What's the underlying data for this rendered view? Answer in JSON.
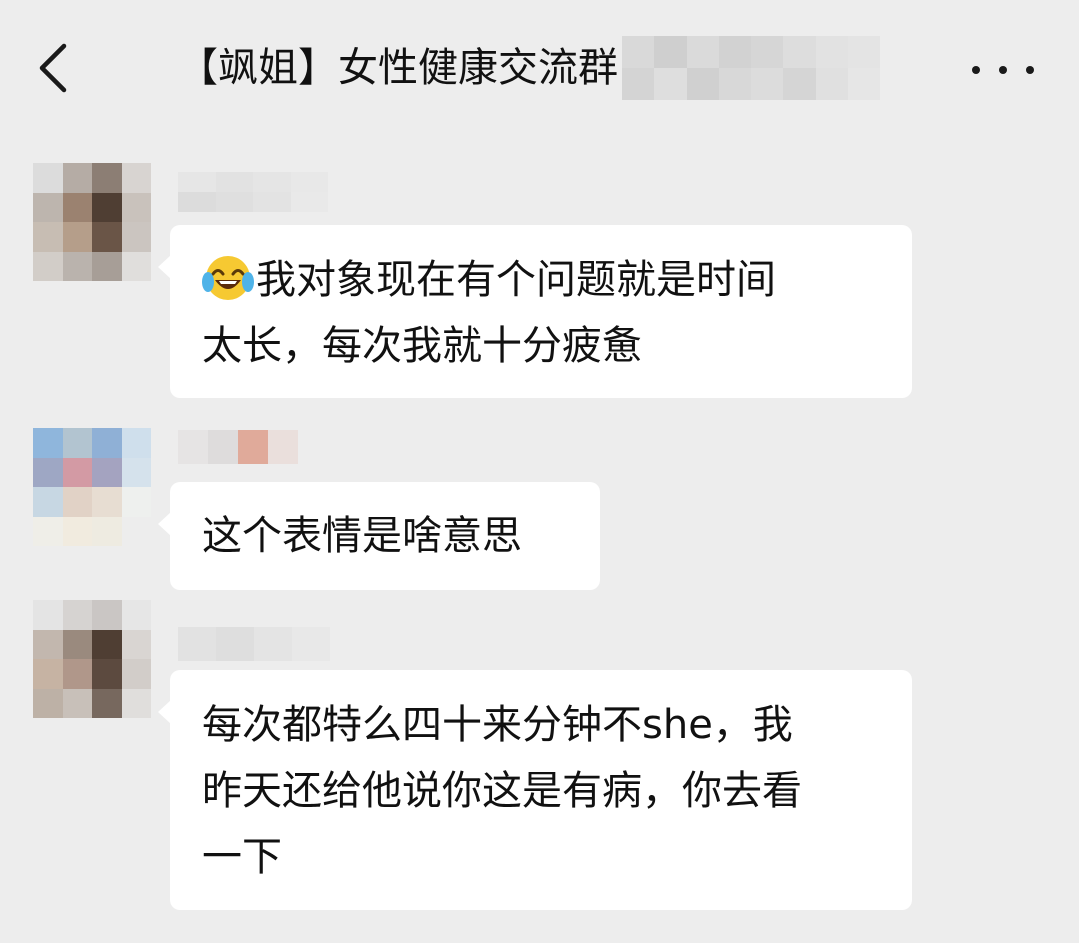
{
  "header": {
    "back_icon": "chevron-left-icon",
    "title": "【飒姐】女性健康交流群",
    "more_icon": "more-horizontal-icon"
  },
  "messages": [
    {
      "emoji": "tears-of-joy-emoji",
      "lines": [
        "我对象现在有个问题就是时间",
        "太长，每次我就十分疲惫"
      ]
    },
    {
      "lines": [
        "这个表情是啥意思"
      ]
    },
    {
      "lines": [
        "每次都特么四十来分钟不she，我",
        "昨天还给他说你这是有病，你去看",
        "一下"
      ]
    }
  ],
  "colors": {
    "background": "#ededed",
    "bubble": "#ffffff",
    "text": "#111111"
  }
}
